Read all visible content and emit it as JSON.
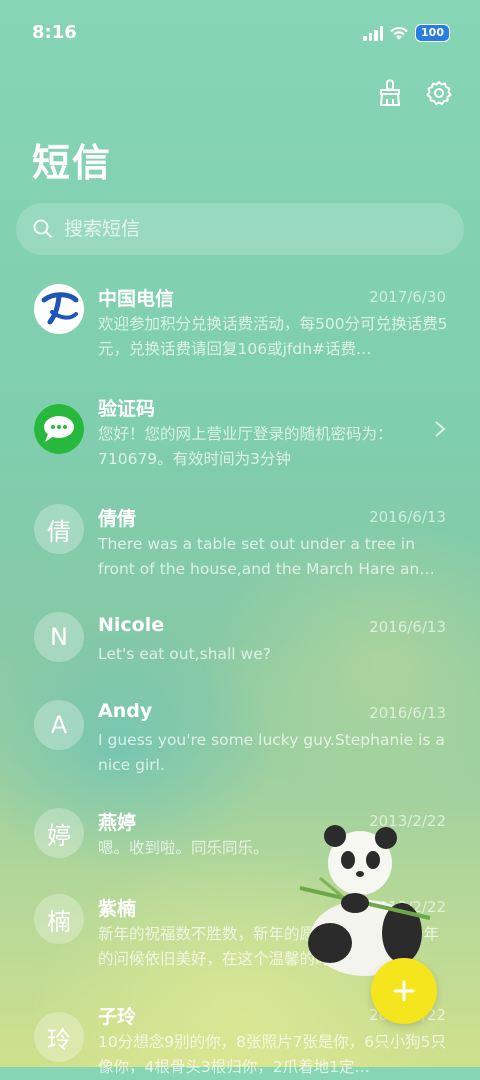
{
  "status": {
    "time": "8:16",
    "battery": "100"
  },
  "header": {
    "title": "短信"
  },
  "search": {
    "placeholder": "搜索短信"
  },
  "conversations": [
    {
      "name": "中国电信",
      "date": "2017/6/30",
      "preview": "欢迎参加积分兑换话费活动，每500分可兑换话费5元，兑换话费请回复106或jfdh#话费…",
      "avatar": "china-telecom-logo"
    },
    {
      "name": "验证码",
      "date": "",
      "preview": "您好！您的网上营业厅登录的随机密码为：710679。有效时间为3分钟",
      "avatar": "message-bubble-logo"
    },
    {
      "name": "倩倩",
      "date": "2016/6/13",
      "preview": "There was a table set out under a tree in front of the house,and the March Hare an…",
      "avatar": "倩"
    },
    {
      "name": "Nicole",
      "date": "2016/6/13",
      "preview": "Let's eat out,shall we?",
      "avatar": "N"
    },
    {
      "name": "Andy",
      "date": "2016/6/13",
      "preview": "I guess you're some lucky guy.Stephanie is a nice girl.",
      "avatar": "A"
    },
    {
      "name": "燕婷",
      "date": "2013/2/22",
      "preview": "嗯。收到啦。同乐同乐。",
      "avatar": "婷"
    },
    {
      "name": "紫楠",
      "date": "2013/2/22",
      "preview": "新年的祝福数不胜数，新年的愿望好多好多，新年的问候依旧美好，在这个温馨的时刻…",
      "avatar": "楠"
    },
    {
      "name": "子玲",
      "date": "2013/2/22",
      "preview": "10分想念9别的你，8张照片7张是你，6只小狗5只像你，4根骨头3根归你，2爪着地1定…",
      "avatar": "玲"
    }
  ],
  "fab": {
    "label": "+"
  }
}
